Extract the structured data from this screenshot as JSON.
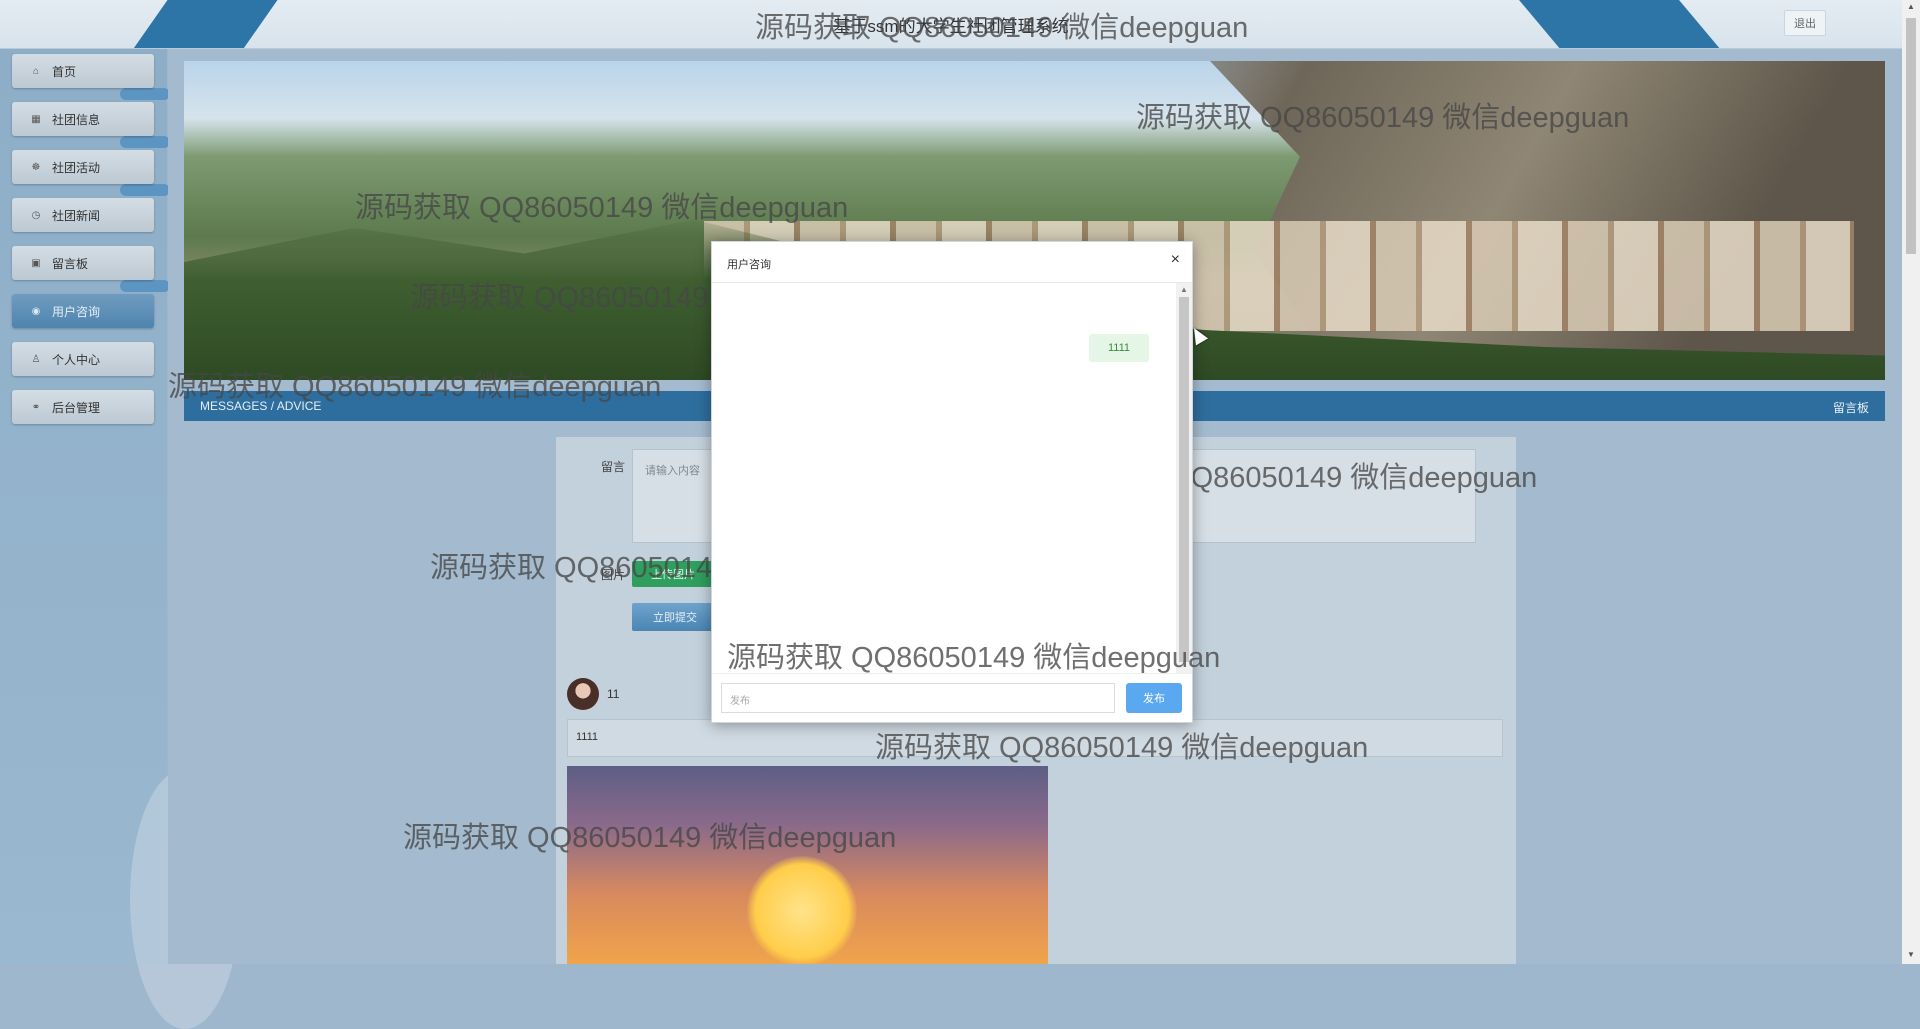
{
  "header": {
    "title": "基于ssm的大学生社团管理系统",
    "logout_label": "退出"
  },
  "sidebar": {
    "items": [
      {
        "label": "首页",
        "icon": "home-icon"
      },
      {
        "label": "社团信息",
        "icon": "info-icon"
      },
      {
        "label": "社团活动",
        "icon": "activity-icon"
      },
      {
        "label": "社团新闻",
        "icon": "news-icon"
      },
      {
        "label": "留言板",
        "icon": "message-icon"
      },
      {
        "label": "用户咨询",
        "icon": "consult-icon"
      },
      {
        "label": "个人中心",
        "icon": "user-icon"
      },
      {
        "label": "后台管理",
        "icon": "link-icon"
      }
    ],
    "active_index": 5
  },
  "section": {
    "title": "MESSAGES / ADVICE",
    "breadcrumb": "留言板"
  },
  "form": {
    "message_label": "留言",
    "message_placeholder": "请输入内容",
    "image_label": "图片",
    "upload_label": "上传图片",
    "submit_label": "立即提交"
  },
  "comment": {
    "username": "11",
    "content": "1111"
  },
  "modal": {
    "title": "用户咨询",
    "close_symbol": "×",
    "messages": [
      {
        "text": "1111",
        "side": "right"
      }
    ],
    "input_placeholder": "发布",
    "send_label": "发布"
  },
  "watermark": {
    "text": "源码获取 QQ86050149 微信deepguan"
  },
  "colors": {
    "primary": "#2e6e9e",
    "send_button": "#5aa8ef",
    "upload_button": "#2f9e5e"
  }
}
